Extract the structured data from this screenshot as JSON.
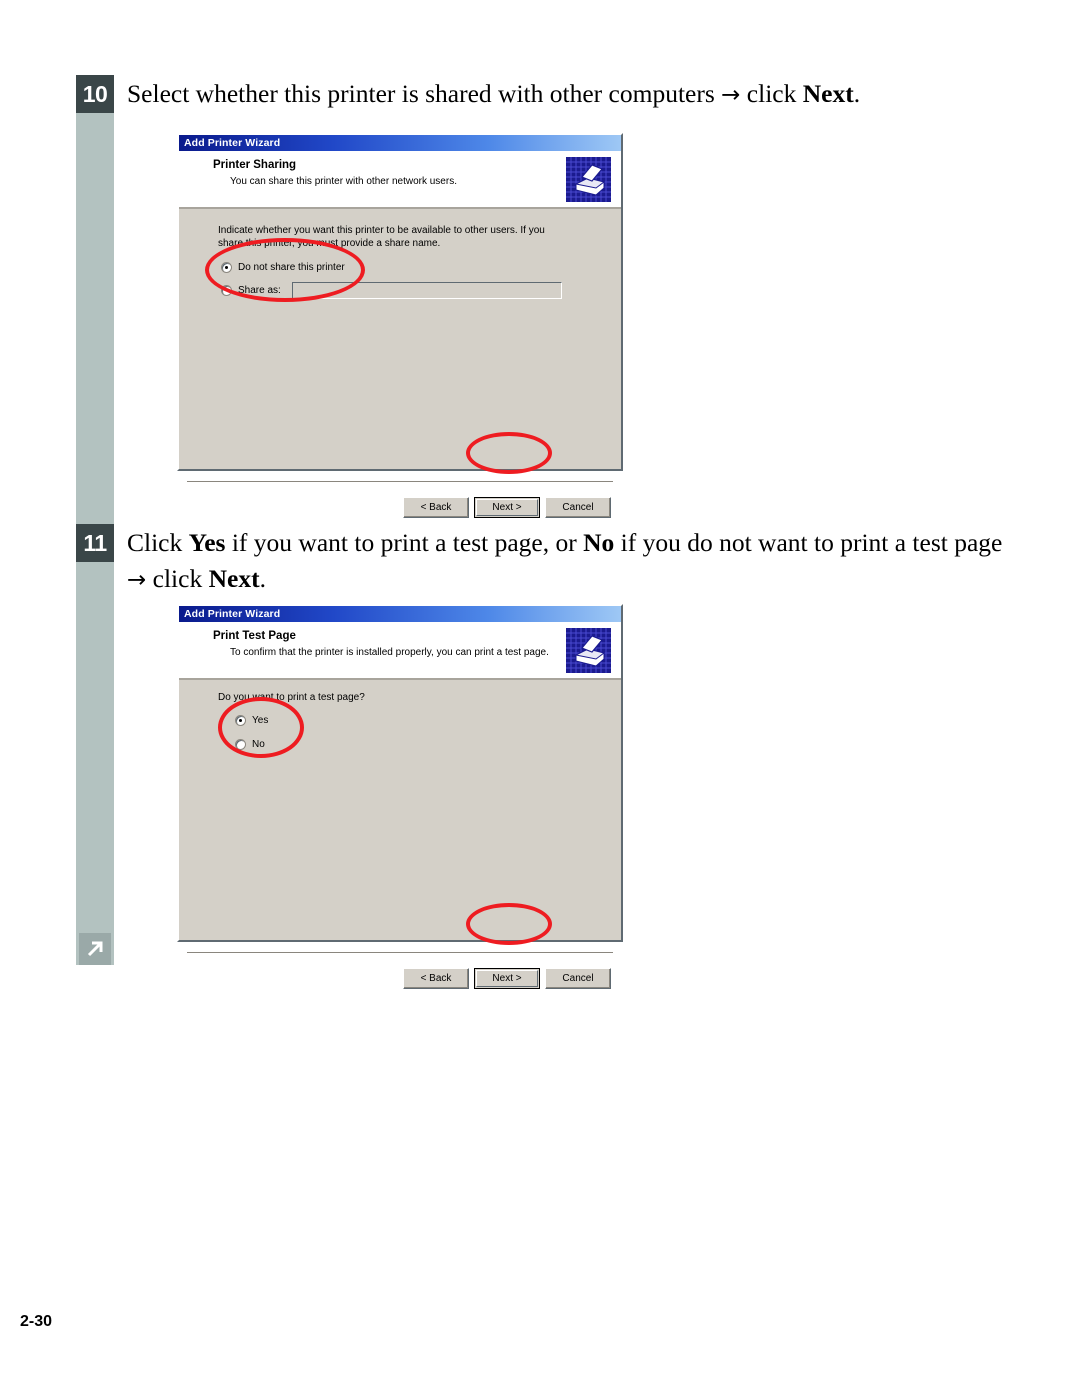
{
  "page": {
    "number": "2-30",
    "rail_icon": "diagonal-arrow-icon"
  },
  "steps": [
    {
      "badge": "10",
      "text_parts": [
        {
          "t": "Select whether this printer is shared with other computers ",
          "b": false
        },
        {
          "t": "→",
          "b": false,
          "arrow": true
        },
        {
          "t": " click ",
          "b": false
        },
        {
          "t": "Next",
          "b": true
        },
        {
          "t": ".",
          "b": false
        }
      ],
      "full_text": "Select whether this printer is shared with other computers → click Next."
    },
    {
      "badge": "11",
      "text_parts": [
        {
          "t": "Click ",
          "b": false
        },
        {
          "t": "Yes",
          "b": true
        },
        {
          "t": " if you want to print a test page, or ",
          "b": false
        },
        {
          "t": "No",
          "b": true
        },
        {
          "t": " if you do not want to print a test page ",
          "b": false
        },
        {
          "t": "→",
          "b": false,
          "arrow": true
        },
        {
          "t": " click ",
          "b": false
        },
        {
          "t": "Next",
          "b": true
        },
        {
          "t": ".",
          "b": false
        }
      ],
      "full_text": "Click Yes if you want to print a test page, or No if you do not want to print a test page → click Next."
    }
  ],
  "dialog1": {
    "titlebar": "Add Printer Wizard",
    "header_title": "Printer Sharing",
    "header_sub": "You can share this printer with other network users.",
    "icon": "printer-icon",
    "body_text": "Indicate whether you want this printer to be available to other users. If you share this printer, you must provide a share name.",
    "radios": [
      {
        "label": "Do not share this printer",
        "selected": true
      },
      {
        "label": "Share as:",
        "selected": false
      }
    ],
    "share_field_value": "",
    "buttons": [
      {
        "label": "< Back",
        "default": false
      },
      {
        "label": "Next >",
        "default": true
      },
      {
        "label": "Cancel",
        "default": false
      }
    ]
  },
  "dialog2": {
    "titlebar": "Add Printer Wizard",
    "header_title": "Print Test Page",
    "header_sub": "To confirm that the printer is installed properly, you can print a test page.",
    "icon": "printer-icon",
    "prompt": "Do you want to print a test page?",
    "radios": [
      {
        "label": "Yes",
        "selected": true
      },
      {
        "label": "No",
        "selected": false
      }
    ],
    "buttons": [
      {
        "label": "< Back",
        "default": false
      },
      {
        "label": "Next >",
        "default": true
      },
      {
        "label": "Cancel",
        "default": false
      }
    ]
  },
  "colors": {
    "rail": "#b3c2c0",
    "badge": "#3a4648",
    "annotation": "#ee1c21",
    "dialog_face": "#d4d0c8",
    "titlebar_start": "#0a1a8c",
    "titlebar_end": "#9ec8f5"
  }
}
